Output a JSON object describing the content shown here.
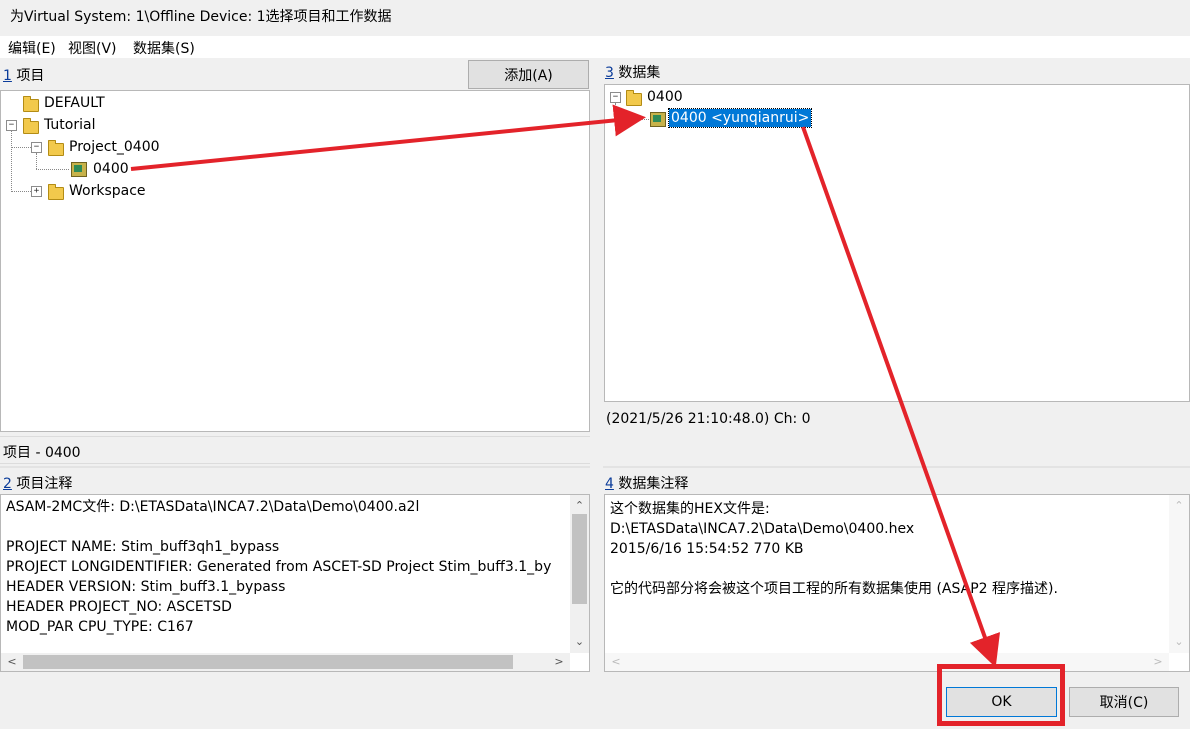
{
  "window": {
    "title": "为Virtual System: 1\\Offline Device: 1选择项目和工作数据"
  },
  "menu": [
    {
      "label": "编辑(E)"
    },
    {
      "label": "视图(V)"
    },
    {
      "label": "数据集(S)"
    }
  ],
  "projects": {
    "num": "1",
    "label": "项目",
    "add_button": "添加(A)",
    "tree": {
      "default": "DEFAULT",
      "tutorial": "Tutorial",
      "project": "Project_0400",
      "item": "0400",
      "workspace": "Workspace"
    },
    "status": "项目 - 0400"
  },
  "datasets": {
    "num": "3",
    "label": "数据集",
    "tree": {
      "folder": "0400",
      "item": "0400 <yunqianrui>"
    },
    "info": "(2021/5/26 21:10:48.0) Ch: 0"
  },
  "project_notes": {
    "num": "2",
    "label": "项目注释",
    "lines": [
      "ASAM-2MC文件: D:\\ETASData\\INCA7.2\\Data\\Demo\\0400.a2l",
      "",
      "PROJECT NAME: Stim_buff3qh1_bypass",
      "PROJECT LONGIDENTIFIER: Generated from ASCET-SD Project Stim_buff3.1_by",
      "HEADER VERSION: Stim_buff3.1_bypass",
      "HEADER PROJECT_NO: ASCETSD",
      "MOD_PAR CPU_TYPE: C167"
    ]
  },
  "dataset_notes": {
    "num": "4",
    "label": "数据集注释",
    "lines": [
      "这个数据集的HEX文件是:",
      "D:\\ETASData\\INCA7.2\\Data\\Demo\\0400.hex",
      "2015/6/16 15:54:52 770 KB",
      "",
      "它的代码部分将会被这个项目工程的所有数据集使用 (ASAP2 程序描述)."
    ]
  },
  "buttons": {
    "ok": "OK",
    "cancel": "取消(C)"
  },
  "colors": {
    "annotation_red": "#e3232a",
    "selection_blue": "#0078d7",
    "link_blue": "#0b3c9a"
  },
  "icons": [
    "folder-icon",
    "cube-icon",
    "expand-minus-icon",
    "expand-plus-icon",
    "scroll-up-icon",
    "scroll-down-icon",
    "scroll-left-icon",
    "scroll-right-icon"
  ]
}
